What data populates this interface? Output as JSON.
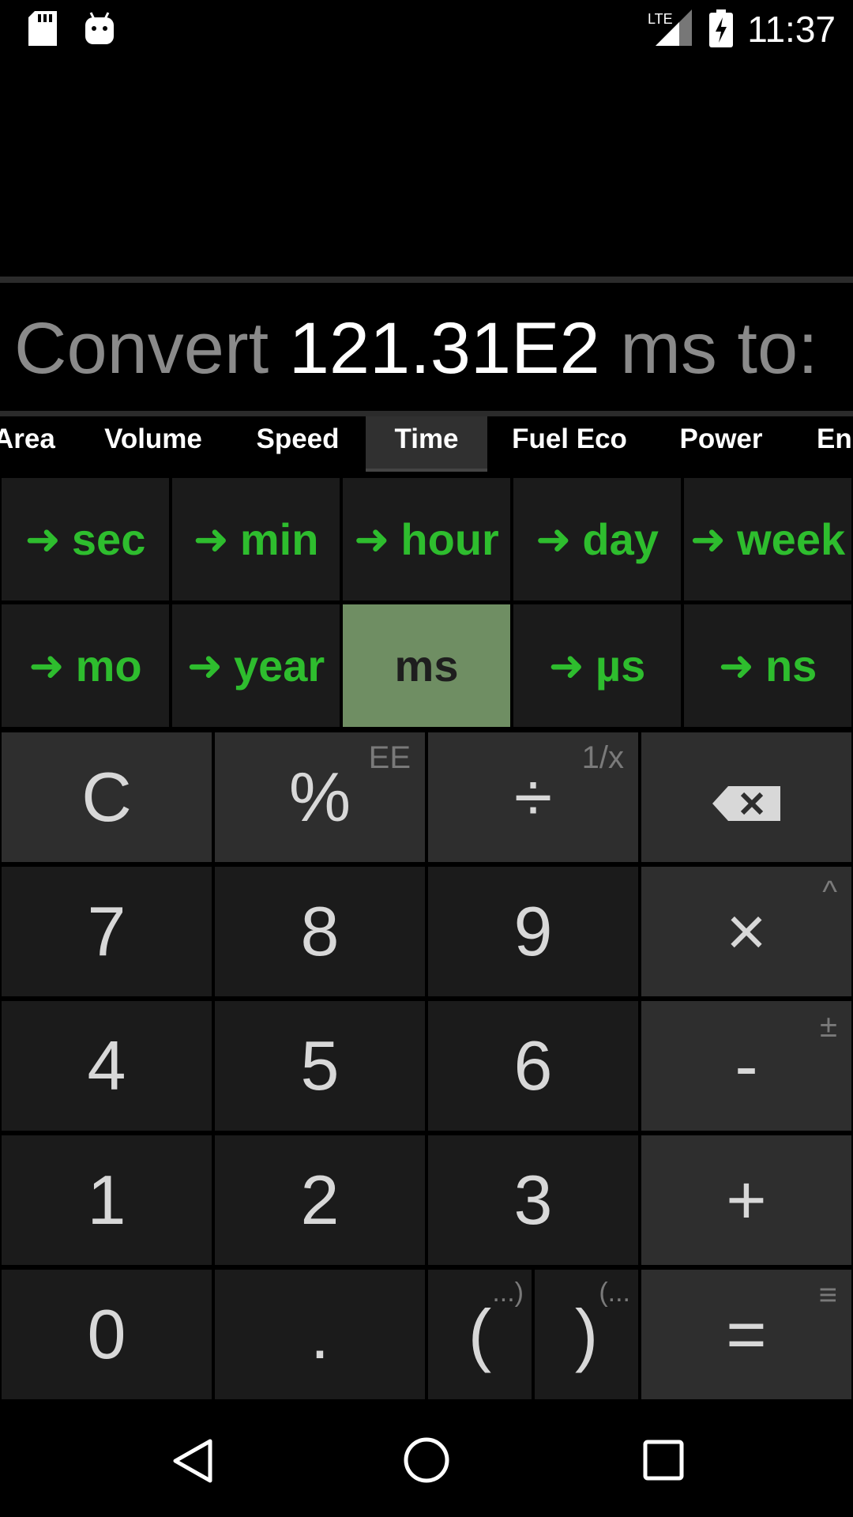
{
  "status_bar": {
    "time": "11:37",
    "icons": [
      "sd-card-icon",
      "android-icon",
      "lte-signal-icon",
      "battery-charging-icon"
    ],
    "lte_label": "LTE"
  },
  "display": {
    "prefix": "Convert",
    "value": "121.31E2",
    "suffix": "ms to:"
  },
  "tabs": {
    "items": [
      "Area",
      "Volume",
      "Speed",
      "Time",
      "Fuel Eco",
      "Power",
      "Energy"
    ],
    "active": "Time",
    "visible_last": "Ene"
  },
  "units": {
    "row1": [
      "sec",
      "min",
      "hour",
      "day",
      "week"
    ],
    "row2": [
      "mo",
      "year",
      "ms",
      "µs",
      "ns"
    ],
    "selected": "ms",
    "arrow": "➜"
  },
  "keypad": {
    "clear": "C",
    "percent": "%",
    "percent_alt": "EE",
    "divide": "÷",
    "divide_alt": "1/x",
    "backspace": "backspace-icon",
    "seven": "7",
    "eight": "8",
    "nine": "9",
    "multiply": "×",
    "multiply_alt": "^",
    "four": "4",
    "five": "5",
    "six": "6",
    "minus": "-",
    "minus_alt": "±",
    "one": "1",
    "two": "2",
    "three": "3",
    "plus": "+",
    "zero": "0",
    "dot": ".",
    "open_paren": "(",
    "open_paren_alt": "...)",
    "close_paren": ")",
    "close_paren_alt": "(...",
    "equals": "=",
    "equals_alt": "≡"
  },
  "nav_bar": {
    "icons": [
      "back-icon",
      "home-icon",
      "recents-icon"
    ]
  },
  "colors": {
    "accent_green": "#2ebd2e",
    "selected_unit_bg": "#6f8e63",
    "key_bg": "#1b1b1b",
    "op_key_bg": "#2e2e2e"
  }
}
